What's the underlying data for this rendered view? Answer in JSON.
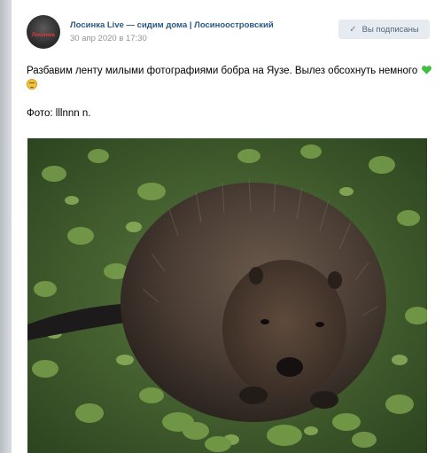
{
  "post": {
    "group_name": "Лосинка Live — сидим дома | Лосиноостровский",
    "date": "30 апр 2020 в 17:30",
    "subscribe_label": "Вы подписаны",
    "text": "Разбавим ленту милыми фотографиями бобра на Яузе. Вылез обсохнуть немного",
    "photo_credit": "Фото: lllnnn n.",
    "avatar_label": "Лосинка"
  },
  "icons": {
    "check": "check-icon",
    "heart": "green-heart-emoji",
    "face": "smiling-face-emoji"
  },
  "colors": {
    "link": "#2a5885",
    "button_bg": "#e5ebf1",
    "button_text": "#55677d",
    "date": "#939393"
  }
}
